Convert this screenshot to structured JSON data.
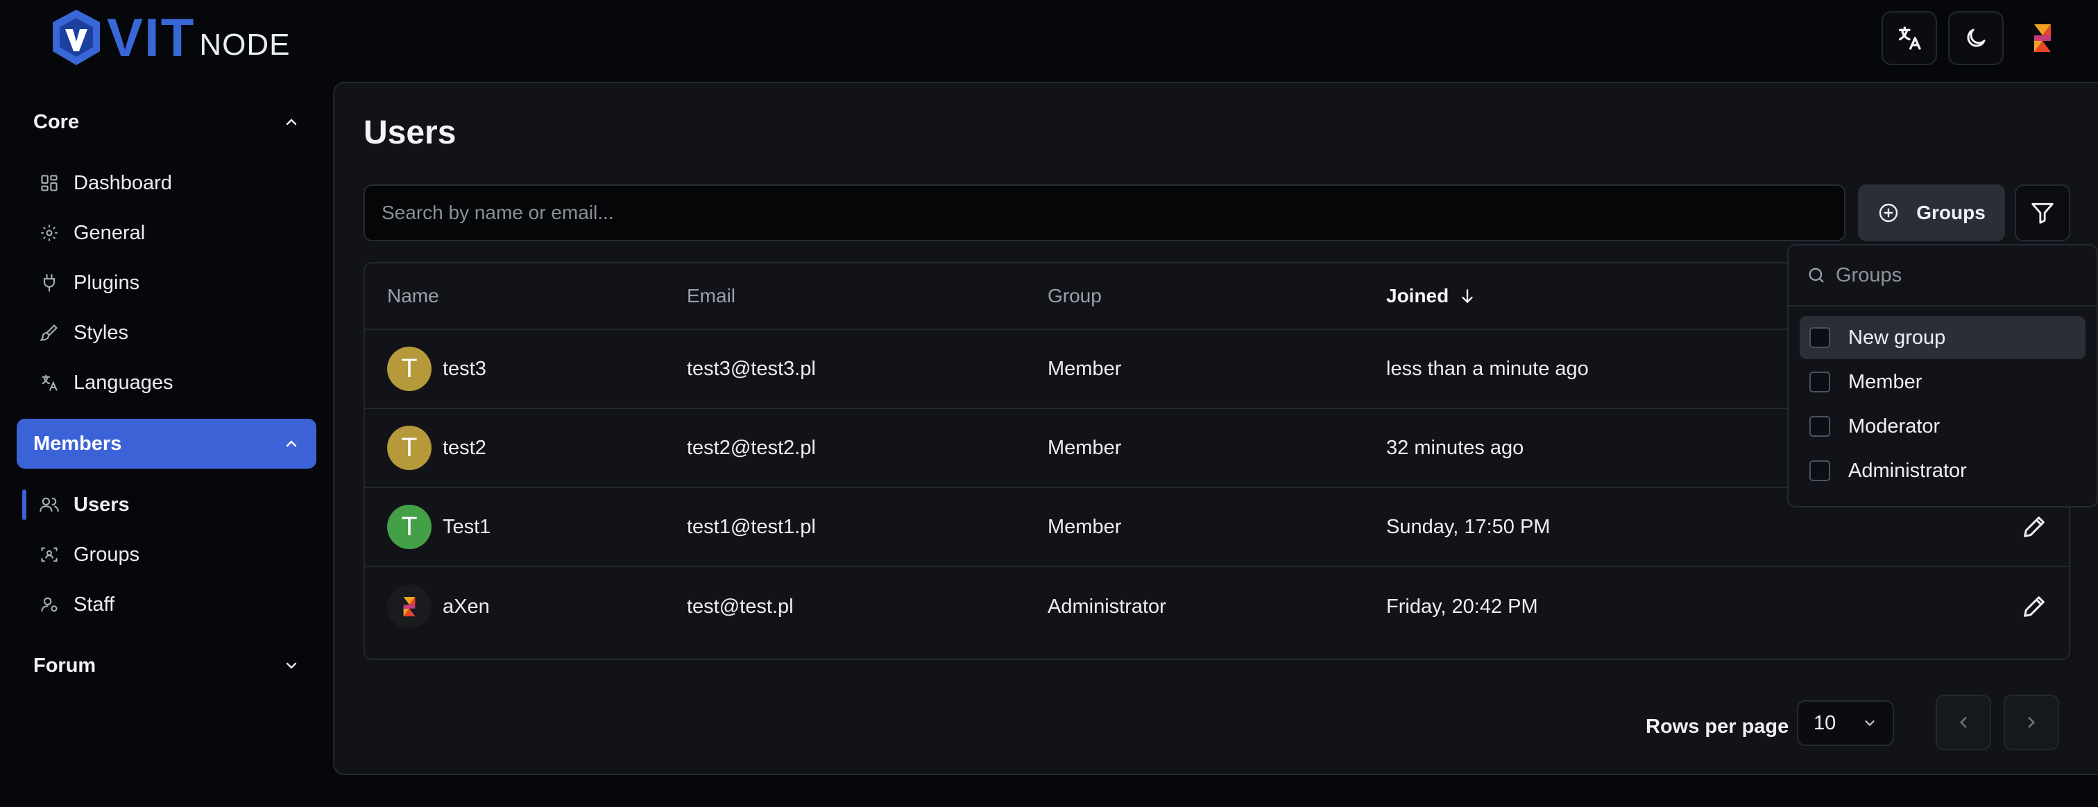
{
  "brand": {
    "name_primary": "VIT",
    "name_secondary": "NODE",
    "accent": "#3c62d8"
  },
  "header": {
    "buttons": [
      {
        "icon": "translate-icon"
      },
      {
        "icon": "moon-icon"
      },
      {
        "icon": "user-avatar"
      }
    ]
  },
  "sidebar": {
    "sections": [
      {
        "label": "Core",
        "expanded": true,
        "items": [
          {
            "label": "Dashboard",
            "icon": "dashboard-icon"
          },
          {
            "label": "General",
            "icon": "gear-icon"
          },
          {
            "label": "Plugins",
            "icon": "plug-icon"
          },
          {
            "label": "Styles",
            "icon": "brush-icon"
          },
          {
            "label": "Languages",
            "icon": "translate-icon"
          }
        ]
      },
      {
        "label": "Members",
        "expanded": true,
        "active": true,
        "items": [
          {
            "label": "Users",
            "icon": "users-icon",
            "active": true
          },
          {
            "label": "Groups",
            "icon": "groups-icon"
          },
          {
            "label": "Staff",
            "icon": "staff-icon"
          }
        ]
      },
      {
        "label": "Forum",
        "expanded": false,
        "items": []
      }
    ]
  },
  "main": {
    "title": "Users",
    "search": {
      "placeholder": "Search by name or email...",
      "value": ""
    },
    "groups_button": "Groups",
    "table": {
      "columns": [
        "Name",
        "Email",
        "Group",
        "Joined"
      ],
      "sorted_column": "Joined",
      "rows": [
        {
          "name": "test3",
          "initial": "T",
          "avatar_color": "#b5993a",
          "email": "test3@test3.pl",
          "group": "Member",
          "joined": "less than a minute ago"
        },
        {
          "name": "test2",
          "initial": "T",
          "avatar_color": "#b5993a",
          "email": "test2@test2.pl",
          "group": "Member",
          "joined": "32 minutes ago"
        },
        {
          "name": "Test1",
          "initial": "T",
          "avatar_color": "#43a047",
          "email": "test1@test1.pl",
          "group": "Member",
          "joined": "Sunday, 17:50 PM"
        },
        {
          "name": "aXen",
          "initial": "",
          "avatar_color": "#1a1b1f",
          "email": "test@test.pl",
          "group": "Administrator",
          "joined": "Friday, 20:42 PM"
        }
      ]
    },
    "pagination": {
      "rows_per_page_label": "Rows per page",
      "rows_per_page": "10"
    }
  },
  "groups_dropdown": {
    "placeholder": "Groups",
    "options": [
      {
        "label": "New group",
        "checked": false,
        "highlighted": true
      },
      {
        "label": "Member",
        "checked": false
      },
      {
        "label": "Moderator",
        "checked": false
      },
      {
        "label": "Administrator",
        "checked": false
      }
    ]
  }
}
